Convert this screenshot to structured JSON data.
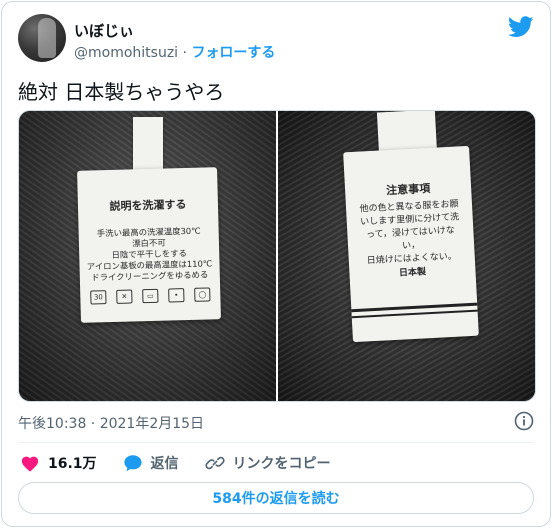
{
  "tweet": {
    "author": {
      "display_name": "いぼじぃ",
      "handle": "@momohitsuzi",
      "separator": "·",
      "follow_label": "フォローする"
    },
    "text": "絶対 日本製ちゃうやろ",
    "media": {
      "left_tag": {
        "title": "説明を洗濯する",
        "lines": [
          "手洗い最高の洗濯温度30℃",
          "漂白不可",
          "日陰で平干しをする",
          "アイロン基板の最高温度は110℃",
          "ドライクリーニングをゆるめる"
        ],
        "icon_names": [
          "wash-30-icon",
          "no-bleach-icon",
          "flat-dry-icon",
          "iron-icon",
          "dry-clean-icon"
        ]
      },
      "right_tag": {
        "title": "注意事項",
        "lines": [
          "他の色と異なる服をお願",
          "いします里側に分けて洗",
          "って，浸けてはいけない，",
          "日焼けにはよくない。"
        ],
        "made_in": "日本製"
      }
    },
    "timestamp": "午後10:38 · 2021年2月15日",
    "actions": {
      "like_count": "16.1万",
      "reply_label": "返信",
      "copy_link_label": "リンクをコピー"
    },
    "replies_button": "584件の返信を読む"
  },
  "colors": {
    "accent": "#1d9bf0",
    "like": "#f91880",
    "text": "#0f1419",
    "secondary": "#536471"
  }
}
